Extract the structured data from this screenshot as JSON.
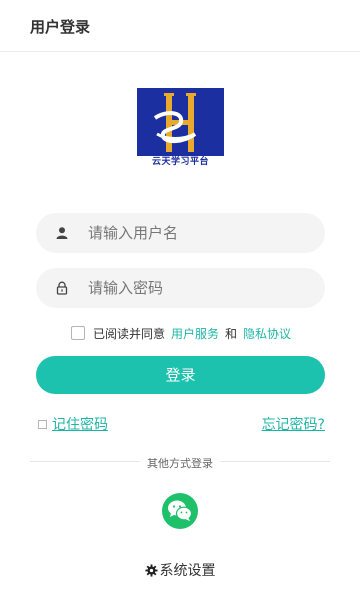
{
  "header": {
    "title": "用户登录"
  },
  "logo": {
    "caption": "云天学习平台"
  },
  "form": {
    "username_placeholder": "请输入用户名",
    "username_value": "",
    "password_placeholder": "请输入密码",
    "password_value": ""
  },
  "agreement": {
    "checked": false,
    "prefix": "已阅读并同意",
    "service_link": "用户服务",
    "conjunction": "和",
    "privacy_link": "隐私协议"
  },
  "login_button": "登录",
  "remember": {
    "label": "记住密码",
    "checked": false
  },
  "forgot_link": "忘记密码?",
  "divider": {
    "label": "其他方式登录"
  },
  "wechat": {
    "icon": "wechat-icon"
  },
  "settings": {
    "label": "系统设置",
    "icon": "gear-icon"
  },
  "colors": {
    "accent": "#1cc2ae",
    "link": "#1fb5a5",
    "wechat": "#1ec16a",
    "logo_bg": "#1b2fa0",
    "field_bg": "#f4f4f4"
  }
}
